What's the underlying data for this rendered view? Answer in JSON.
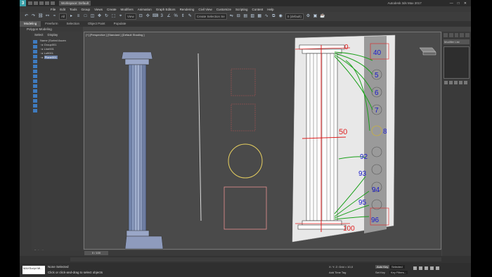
{
  "titlebar": {
    "logo": "3",
    "workspace": "Workspace: Default",
    "title": "Autodesk 3ds Max 2017",
    "controls": [
      "—",
      "□",
      "✕"
    ]
  },
  "menubar": [
    "File",
    "Edit",
    "Tools",
    "Group",
    "Views",
    "Create",
    "Modifiers",
    "Animation",
    "Graph Editors",
    "Rendering",
    "Civil View",
    "Customize",
    "Scripting",
    "Content",
    "Help"
  ],
  "toolbar": {
    "filter": "All",
    "view": "View",
    "selection_set": "Create Selection Se",
    "layer": "0 (default)"
  },
  "ribbon": {
    "tabs": [
      "Modeling",
      "Freeform",
      "Selection",
      "Object Paint",
      "Populate"
    ],
    "active_tab": "Modeling",
    "sub": "Polygon Modeling"
  },
  "explorer": {
    "tabs": [
      "Select",
      "Display"
    ],
    "header": "Name (Sorted Ascen",
    "items": [
      {
        "label": "Group001",
        "selected": false
      },
      {
        "label": "Line001",
        "selected": false
      },
      {
        "label": "Loft001",
        "selected": false
      },
      {
        "label": "Plane001",
        "selected": true
      }
    ],
    "footer": "Default"
  },
  "viewport": {
    "label": "[+] [Perspective ] [Standard ] [Default Shading ]"
  },
  "annotations": {
    "labels": [
      "0",
      "40",
      "5",
      "6",
      "7",
      "50",
      "8",
      "92",
      "93",
      "94",
      "95",
      "96",
      "100"
    ],
    "ink_green": "#1aa01a",
    "ink_red": "#e02020",
    "ink_blue": "#1a1acc"
  },
  "command_panel": {
    "modifier_list": "Modifier List"
  },
  "timeline": {
    "frame_counter": "0 / 100"
  },
  "statusbar": {
    "maxscript": "MAXScript Mi...",
    "status": "None Selected",
    "prompt": "Click or click-and-drag to select objects",
    "coords": "X:   Y:   Z:   Grid = 10,0",
    "add_time_tag": "Add Time Tag",
    "auto_key": "Auto Key",
    "selected": "Selected",
    "set_key": "Set Key",
    "key_filters": "Key Filters..."
  }
}
